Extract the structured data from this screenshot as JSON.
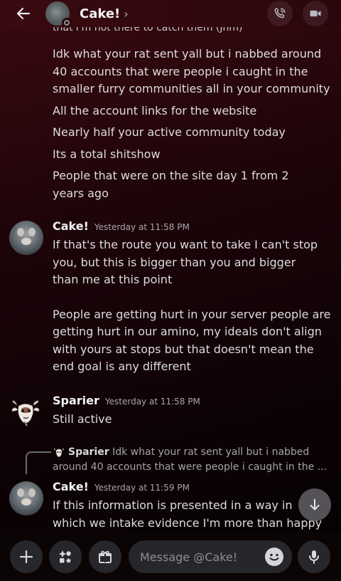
{
  "header": {
    "title": "Cake!",
    "chevron": "›",
    "back_icon": "arrow-left-icon",
    "call_icon": "phone-call-icon",
    "video_icon": "video-camera-icon"
  },
  "cutoff_text": "that i'm not there to catch them (Jhm)",
  "first_block": {
    "lines": [
      "Idk what your rat sent yall but i nabbed around 40 accounts that were people i caught in the smaller furry communities all in your community",
      "All the account links for the website",
      "Nearly half your active community today",
      "Its a total shitshow",
      "People that were on the site day 1 from 2 years ago"
    ]
  },
  "messages": [
    {
      "author": "Cake!",
      "time": "Yesterday at 11:58 PM",
      "paragraphs": [
        "If that's the route you want to take I can't stop you, but this is bigger than you and bigger than me at this point",
        "People are getting hurt in your server people are getting hurt in our amino, my ideals don't align with yours at stops but that doesn't mean the end goal is any different"
      ]
    },
    {
      "author": "Sparier",
      "time": "Yesterday at 11:58 PM",
      "paragraphs": [
        "Still active"
      ]
    },
    {
      "author": "Cake!",
      "time": "Yesterday at 11:59 PM",
      "paragraphs": [
        "If this information is presented in a way in which we intake evidence I'm more than happy to take"
      ]
    }
  ],
  "reply": {
    "author": "Sparier",
    "text": "Idk what your rat sent yall but i nabbed around 40 accounts that were people i caught in the ..."
  },
  "composer": {
    "placeholder": "Message @Cake!",
    "add_icon": "plus-icon",
    "apps_icon": "apps-icon",
    "gift_icon": "gift-icon",
    "emoji_icon": "emoji-icon",
    "mic_icon": "microphone-icon"
  },
  "jump_icon": "arrow-down-icon"
}
